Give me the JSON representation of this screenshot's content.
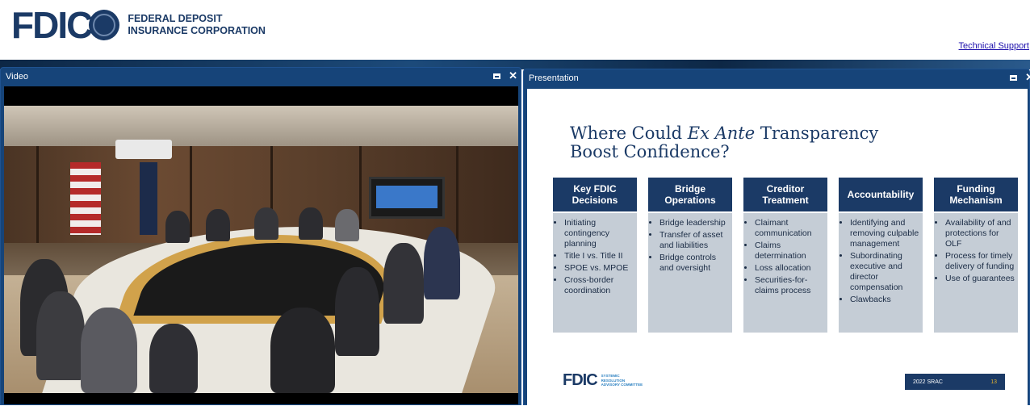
{
  "header": {
    "logo_mark": "FDIC",
    "logo_line1": "FEDERAL DEPOSIT",
    "logo_line2": "INSURANCE CORPORATION",
    "tech_support": "Technical Support"
  },
  "video_panel": {
    "title": "Video"
  },
  "presentation_panel": {
    "title": "Presentation"
  },
  "icons": {
    "maximize": "maximize-icon",
    "close": "close-icon"
  },
  "slide": {
    "title_pre": "Where Could ",
    "title_em": "Ex Ante",
    "title_post": " Transparency Boost Confidence?",
    "columns": [
      {
        "heading": "Key FDIC Decisions",
        "items": [
          "Initiating contingency planning",
          "Title I vs. Title II",
          "SPOE vs. MPOE",
          "Cross-border coordination"
        ]
      },
      {
        "heading": "Bridge Operations",
        "items": [
          "Bridge leadership",
          "Transfer of asset and liabilities",
          "Bridge controls and oversight"
        ]
      },
      {
        "heading": "Creditor Treatment",
        "items": [
          "Claimant communication",
          "Claims determination",
          "Loss allocation",
          "Securities-for-claims process"
        ]
      },
      {
        "heading": "Accountability",
        "items": [
          "Identifying and removing culpable management",
          "Subordinating executive and director compensation",
          "Clawbacks"
        ]
      },
      {
        "heading": "Funding Mechanism",
        "items": [
          "Availability of and protections for OLF",
          "Process for timely delivery of funding",
          "Use of guarantees"
        ]
      }
    ],
    "footer_logo": "FDIC",
    "footer_logo_sub": [
      "SYSTEMIC",
      "RESOLUTION",
      "ADVISORY COMMITTEE"
    ],
    "footer_label": "2022 SRAC",
    "page_number": "13"
  },
  "colors": {
    "brand": "#1b3a66",
    "panel_bar": "#164479",
    "column_body": "#c5cdd6"
  }
}
